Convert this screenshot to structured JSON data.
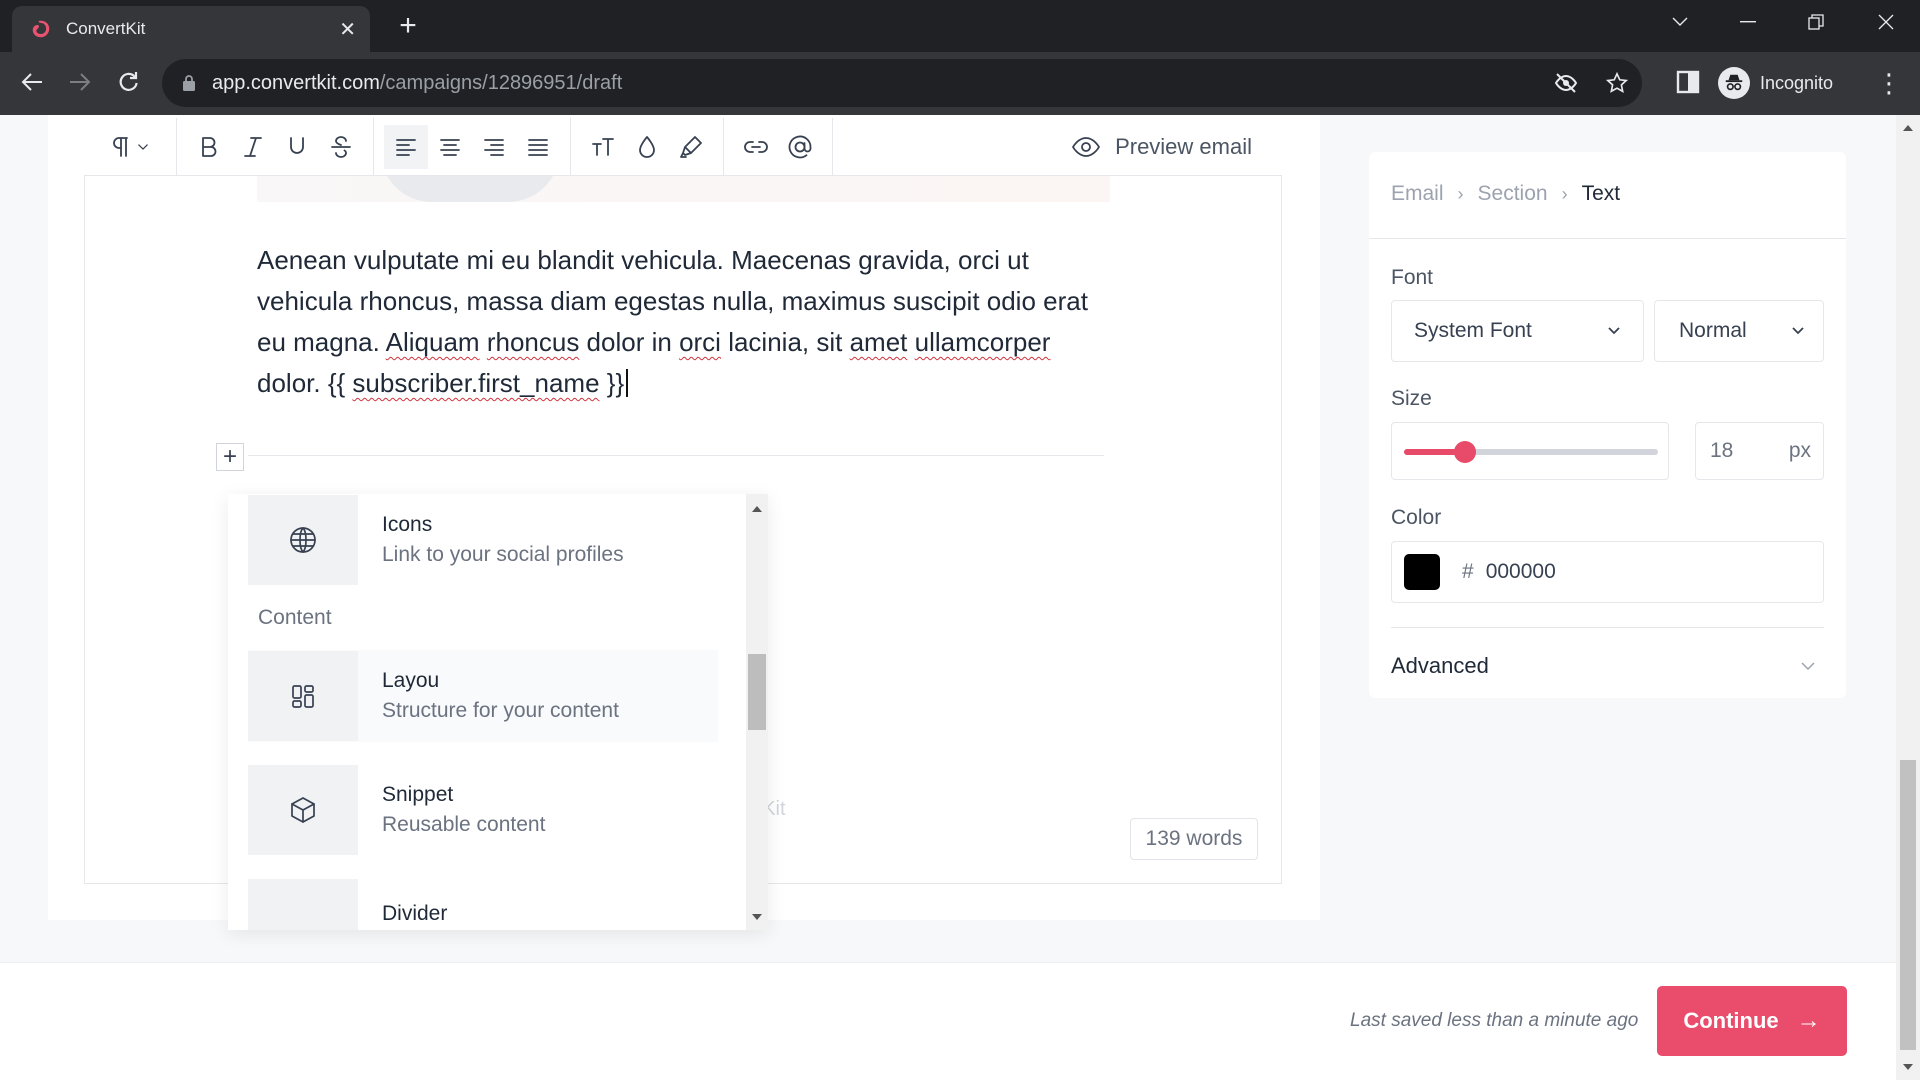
{
  "browser": {
    "tab_title": "ConvertKit",
    "url_host": "app.convertkit.com",
    "url_path": "/campaigns/12896951/draft",
    "profile_label": "Incognito"
  },
  "toolbar": {
    "buttons": [
      {
        "name": "paragraph-style",
        "icon": "pilcrow-icon"
      },
      {
        "name": "bold",
        "icon": "bold-icon"
      },
      {
        "name": "italic",
        "icon": "italic-icon"
      },
      {
        "name": "underline",
        "icon": "underline-icon"
      },
      {
        "name": "strikethrough",
        "icon": "strikethrough-icon"
      },
      {
        "name": "align-left",
        "icon": "align-left-icon",
        "active": true
      },
      {
        "name": "align-center",
        "icon": "align-center-icon"
      },
      {
        "name": "align-right",
        "icon": "align-right-icon"
      },
      {
        "name": "align-justify",
        "icon": "align-justify-icon"
      },
      {
        "name": "font-size",
        "icon": "text-size-icon"
      },
      {
        "name": "text-color",
        "icon": "droplet-icon"
      },
      {
        "name": "highlight",
        "icon": "highlighter-icon"
      },
      {
        "name": "link",
        "icon": "link-icon"
      },
      {
        "name": "mention",
        "icon": "at-sign-icon"
      }
    ],
    "preview_label": "Preview email"
  },
  "editor": {
    "body": {
      "part1": "Aenean vulputate mi eu blandit vehicula. Maecenas gravida, orci ut vehicula rhoncus, massa diam egestas nulla, maximus suscipit odio erat eu magna. ",
      "w1": "Aliquam",
      "w2": "rhoncus",
      "part2": " dolor in ",
      "w3": "orci",
      "part3": " lacinia, sit ",
      "w4": "amet",
      "w5": "ullamcorper",
      "part4": " dolor. {{ ",
      "w6": "subscriber.first_name",
      "part5": " }}"
    },
    "footer_ghost": "rtKit",
    "word_count": "139 words"
  },
  "block_menu": {
    "items_above": [
      {
        "title": "Icons",
        "description": "Link to your social profiles",
        "icon": "globe-icon"
      }
    ],
    "section_label": "Content",
    "items": [
      {
        "title": "Layout",
        "title_visible": "Layou",
        "description": "Structure for your content",
        "icon": "layout-grid-icon",
        "hovered": true
      },
      {
        "title": "Snippet",
        "description": "Reusable content",
        "icon": "cube-icon"
      },
      {
        "title": "Divider",
        "description": "",
        "icon": "divider-icon"
      }
    ]
  },
  "panel": {
    "breadcrumb": [
      "Email",
      "Section",
      "Text"
    ],
    "font_label": "Font",
    "font_family": "System Font",
    "font_weight": "Normal",
    "size_label": "Size",
    "size_value": "18",
    "size_unit": "px",
    "size_slider_fraction": 0.24,
    "color_label": "Color",
    "color_hash": "#",
    "color_value": "000000",
    "color_swatch": "#000000",
    "advanced_label": "Advanced"
  },
  "bottom": {
    "saved_status": "Last saved less than a minute ago",
    "continue_label": "Continue"
  },
  "colors": {
    "accent": "#ea4c6c",
    "slider": "#e84a6a",
    "favicon": "#e8546f"
  }
}
